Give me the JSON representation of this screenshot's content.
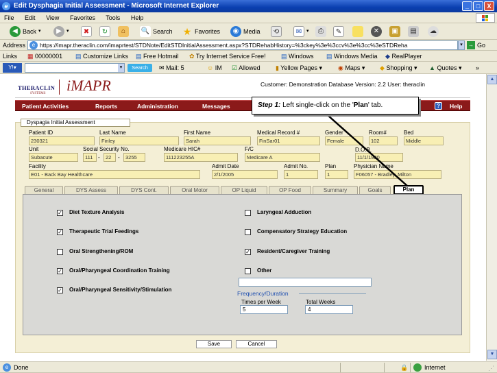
{
  "window": {
    "title": "Edit Dysphagia Initial Assessment - Microsoft Internet Explorer",
    "min": "_",
    "max": "□",
    "close": "X"
  },
  "menu": [
    "File",
    "Edit",
    "View",
    "Favorites",
    "Tools",
    "Help"
  ],
  "toolbar": {
    "back": "Back",
    "search": "Search",
    "favorites": "Favorites",
    "media": "Media"
  },
  "address": {
    "label": "Address",
    "url": "https://imapr.theraclin.com/imaprtest/STDNote/EditSTDInitialAssessment.aspx?STDRehabHistory=%3ckey%3e%3ccv%3e%3cc%3eSTDReha",
    "go": "Go"
  },
  "links": {
    "label": "Links",
    "items": [
      "00000001",
      "Customize Links",
      "Free Hotmail",
      "Try Internet Service Free!",
      "Windows",
      "Windows Media",
      "RealPlayer"
    ]
  },
  "searchbar": {
    "search_btn": "Search",
    "mail": "Mail: 5",
    "im": "IM",
    "allowed": "Allowed",
    "yellow": "Yellow Pages",
    "maps": "Maps",
    "shopping": "Shopping",
    "quotes": "Quotes"
  },
  "app": {
    "logo_main": "THERACLIN",
    "logo_sub": "SYSTEMS",
    "logo_prod": "iMAPR",
    "customer": "Customer: Demonstration Database Version: 2.2 User: theraclin"
  },
  "nav": [
    "Patient Activities",
    "Reports",
    "Administration",
    "Messages",
    "Help"
  ],
  "callout": {
    "step": "Step 1:",
    "text": " Left single-click on the '",
    "target": "Plan",
    "end": "' tab."
  },
  "form": {
    "title": "Dyspagia Initial Assessment",
    "patient_id": {
      "label": "Patient ID",
      "value": "230321"
    },
    "last_name": {
      "label": "Last Name",
      "value": "Finley"
    },
    "first_name": {
      "label": "First Name",
      "value": "Sarah"
    },
    "mrn": {
      "label": "Medical Record #",
      "value": "FinSar01"
    },
    "gender": {
      "label": "Gender",
      "value": "Female"
    },
    "room": {
      "label": "Room#",
      "value": "102"
    },
    "bed": {
      "label": "Bed",
      "value": "Middle"
    },
    "unit": {
      "label": "Unit",
      "value": "Subacute"
    },
    "ssn": {
      "label": "Social Security No.",
      "p1": "111",
      "p2": "22",
      "p3": "3255",
      "sep": "-"
    },
    "medicare": {
      "label": "Medicare HIC#",
      "value": "111223255A"
    },
    "fc": {
      "label": "F/C",
      "value": "Medicare A"
    },
    "dob": {
      "label": "D.O.B.",
      "value": "11/1/1920"
    },
    "facility": {
      "label": "Facility",
      "value": "E01 - Back Bay Healthcare"
    },
    "admit_date": {
      "label": "Admit Date",
      "value": "2/1/2005"
    },
    "admit_no": {
      "label": "Admit No.",
      "value": "1"
    },
    "plan": {
      "label": "Plan",
      "value": "1"
    },
    "physician": {
      "label": "Physician Name",
      "value": "F06057 - Bradley, Milton"
    }
  },
  "tabs": [
    "General",
    "DYS Assess",
    "DYS Cont.",
    "Oral Motor",
    "OP Liquid",
    "OP Food",
    "Summary",
    "Goals",
    "Plan"
  ],
  "plan": {
    "left": [
      {
        "label": "Diet Texture Analysis",
        "checked": true
      },
      {
        "label": "Therapeutic Trial Feedings",
        "checked": true
      },
      {
        "label": "Oral Strengthening/ROM",
        "checked": false
      },
      {
        "label": "Oral/Pharyngeal Coordination Training",
        "checked": true
      },
      {
        "label": "Oral/Pharyngeal Sensitivity/Stimulation",
        "checked": true
      }
    ],
    "right": [
      {
        "label": "Laryngeal Adduction",
        "checked": false
      },
      {
        "label": "Compensatory Strategy Education",
        "checked": false
      },
      {
        "label": "Resident/Caregiver Training",
        "checked": true
      },
      {
        "label": "Other",
        "checked": false
      }
    ],
    "freq_title": "Frequency/Duration",
    "times_label": "Times per Week",
    "times_value": "5",
    "weeks_label": "Total Weeks",
    "weeks_value": "4",
    "save": "Save",
    "cancel": "Cancel",
    "check": "✓"
  },
  "status": {
    "done": "Done",
    "zone": "Internet"
  }
}
